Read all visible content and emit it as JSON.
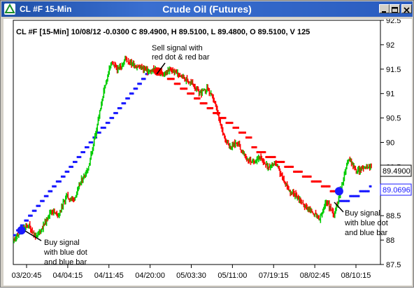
{
  "window": {
    "title": "CL #F 15-Min",
    "app_title": "Crude Oil (Futures)"
  },
  "header": {
    "ohlc_line": "CL #F [15-Min] 10/08/12  -0.0300 C 89.4900, H 89.5100, L 89.4800, O 89.5100, V 125"
  },
  "price_axis": {
    "ticks": [
      "92.5",
      "92",
      "91.5",
      "91",
      "90.5",
      "90",
      "89.5",
      "89",
      "88.5",
      "88",
      "87.5"
    ],
    "last_price": "89.4900",
    "stop_price": "89.0696",
    "last_color": "#000000",
    "stop_color": "#1a1aff"
  },
  "time_axis": {
    "ticks": [
      "03/20:45",
      "04/04:15",
      "04/11:45",
      "04/20:00",
      "05/03:30",
      "05/11:00",
      "07/19:15",
      "08/02:45",
      "08/10:15"
    ]
  },
  "annotations": {
    "sell": [
      "Sell signal with",
      "red dot & red bar"
    ],
    "buy_left": [
      "Buy signal",
      "with blue dot",
      "and blue bar"
    ],
    "buy_right": [
      "Buy signal",
      "with blue dot",
      "and blue bar"
    ]
  },
  "colors": {
    "up_bar": "#00cc00",
    "down_bar": "#ff0000",
    "buy_stop": "#1a1aff",
    "sell_stop": "#ff0000",
    "title_bar": "#2a5cbf"
  },
  "chart_data": {
    "type": "bar",
    "style": "ohlc",
    "y_range": [
      87.5,
      92.5
    ],
    "price_series": [
      [
        0,
        88.0
      ],
      [
        3,
        88.2
      ],
      [
        6,
        88.3
      ],
      [
        9,
        88.05
      ],
      [
        12,
        88.3
      ],
      [
        15,
        88.6
      ],
      [
        18,
        88.5
      ],
      [
        21,
        88.9
      ],
      [
        24,
        88.8
      ],
      [
        27,
        89.2
      ],
      [
        30,
        89.5
      ],
      [
        33,
        90.2
      ],
      [
        36,
        91.0
      ],
      [
        39,
        91.6
      ],
      [
        42,
        91.5
      ],
      [
        45,
        91.7
      ],
      [
        48,
        91.6
      ],
      [
        51,
        91.55
      ],
      [
        54,
        91.45
      ],
      [
        57,
        91.5
      ],
      [
        60,
        91.4
      ],
      [
        63,
        91.5
      ],
      [
        66,
        91.4
      ],
      [
        69,
        91.3
      ],
      [
        72,
        91.2
      ],
      [
        75,
        91.0
      ],
      [
        78,
        91.1
      ],
      [
        81,
        90.8
      ],
      [
        84,
        90.2
      ],
      [
        87,
        89.9
      ],
      [
        90,
        90.0
      ],
      [
        93,
        89.7
      ],
      [
        96,
        89.6
      ],
      [
        99,
        89.7
      ],
      [
        102,
        89.5
      ],
      [
        105,
        89.6
      ],
      [
        108,
        89.3
      ],
      [
        111,
        89.0
      ],
      [
        114,
        88.9
      ],
      [
        117,
        88.7
      ],
      [
        120,
        88.6
      ],
      [
        123,
        88.4
      ],
      [
        126,
        88.8
      ],
      [
        129,
        88.5
      ],
      [
        132,
        89.1
      ],
      [
        135,
        89.7
      ],
      [
        138,
        89.4
      ],
      [
        141,
        89.5
      ],
      [
        144,
        89.49
      ]
    ],
    "signals": [
      {
        "type": "buy",
        "x": 3,
        "price": 88.2
      },
      {
        "type": "sell",
        "x": 58,
        "price": 91.45
      },
      {
        "type": "buy",
        "x": 131,
        "price": 89.0
      }
    ],
    "stop_segments": [
      {
        "side": "buy",
        "x0": 0,
        "x1": 54,
        "start": 88.1,
        "end": 91.4
      },
      {
        "side": "sell",
        "x0": 58,
        "x1": 96,
        "start": 91.5,
        "end": 90.05
      },
      {
        "side": "sell",
        "x0": 96,
        "x1": 131,
        "start": 89.9,
        "end": 88.95
      },
      {
        "side": "buy",
        "x0": 131,
        "x1": 144,
        "start": 88.75,
        "end": 89.07
      }
    ]
  }
}
